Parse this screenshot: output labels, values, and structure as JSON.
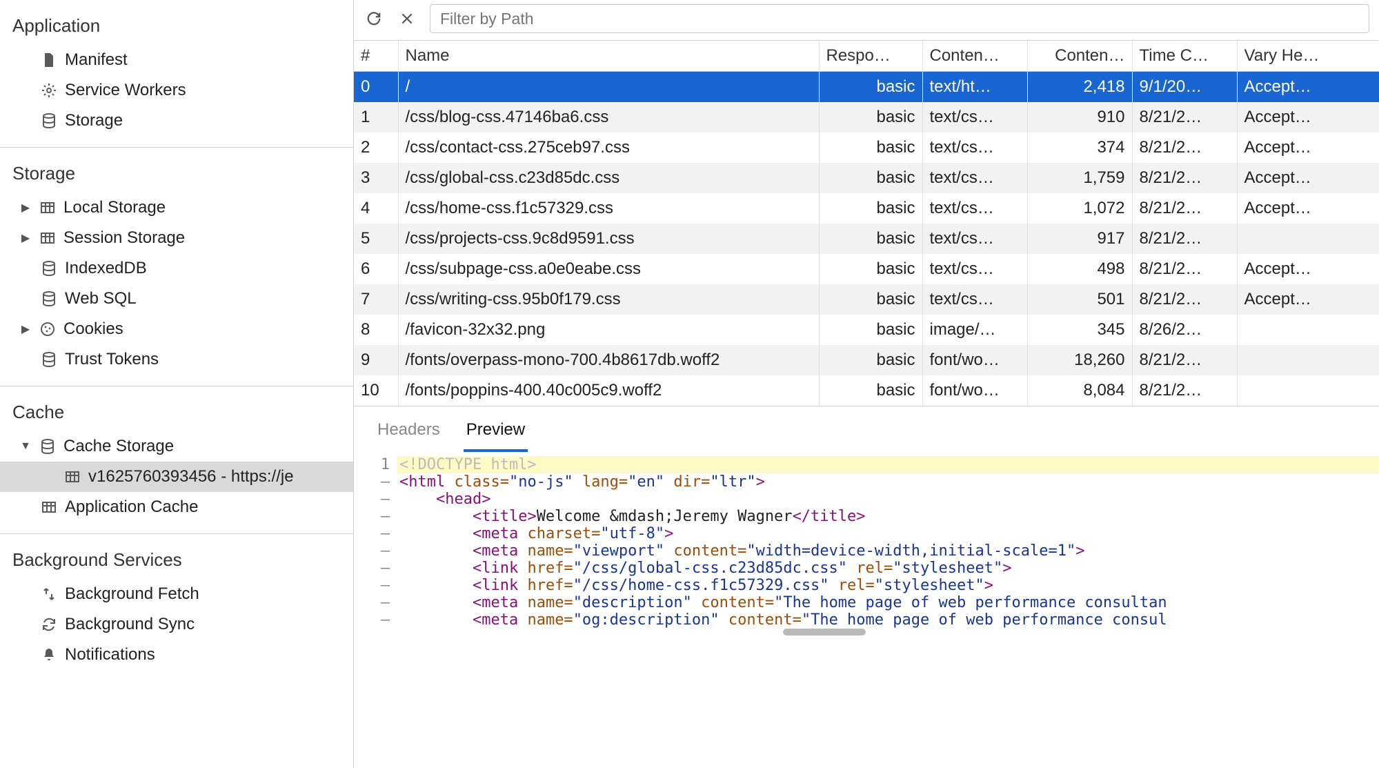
{
  "sidebar": {
    "sections": [
      {
        "header": "Application",
        "items": [
          {
            "name": "manifest",
            "icon": "file-icon",
            "label": "Manifest"
          },
          {
            "name": "service-workers",
            "icon": "gear-icon",
            "label": "Service Workers"
          },
          {
            "name": "storage",
            "icon": "database-icon",
            "label": "Storage"
          }
        ]
      },
      {
        "header": "Storage",
        "items": [
          {
            "name": "local-storage",
            "icon": "table-icon",
            "label": "Local Storage",
            "tree": true,
            "arrow": "▶"
          },
          {
            "name": "session-storage",
            "icon": "table-icon",
            "label": "Session Storage",
            "tree": true,
            "arrow": "▶"
          },
          {
            "name": "indexeddb",
            "icon": "database-icon",
            "label": "IndexedDB"
          },
          {
            "name": "web-sql",
            "icon": "database-icon",
            "label": "Web SQL"
          },
          {
            "name": "cookies",
            "icon": "cookie-icon",
            "label": "Cookies",
            "tree": true,
            "arrow": "▶"
          },
          {
            "name": "trust-tokens",
            "icon": "database-icon",
            "label": "Trust Tokens"
          }
        ]
      },
      {
        "header": "Cache",
        "items": [
          {
            "name": "cache-storage",
            "icon": "database-icon",
            "label": "Cache Storage",
            "tree": true,
            "arrow": "▼"
          },
          {
            "name": "cache-entry",
            "icon": "table-icon",
            "label": "v1625760393456 - https://je",
            "indent": 2,
            "selected": true
          },
          {
            "name": "application-cache",
            "icon": "table-icon",
            "label": "Application Cache"
          }
        ]
      },
      {
        "header": "Background Services",
        "no_border": true,
        "items": [
          {
            "name": "background-fetch",
            "icon": "fetch-icon",
            "label": "Background Fetch"
          },
          {
            "name": "background-sync",
            "icon": "sync-icon",
            "label": "Background Sync"
          },
          {
            "name": "notifications",
            "icon": "bell-icon",
            "label": "Notifications"
          }
        ]
      }
    ]
  },
  "toolbar": {
    "filter_placeholder": "Filter by Path"
  },
  "table": {
    "columns": [
      "#",
      "Name",
      "Respo…",
      "Conten…",
      "Conten…",
      "Time C…",
      "Vary He…"
    ],
    "rows": [
      {
        "idx": "0",
        "name": "/",
        "resp": "basic",
        "ct": "text/ht…",
        "cl": "2,418",
        "tc": "9/1/20…",
        "vh": "Accept…",
        "selected": true
      },
      {
        "idx": "1",
        "name": "/css/blog-css.47146ba6.css",
        "resp": "basic",
        "ct": "text/cs…",
        "cl": "910",
        "tc": "8/21/2…",
        "vh": "Accept…"
      },
      {
        "idx": "2",
        "name": "/css/contact-css.275ceb97.css",
        "resp": "basic",
        "ct": "text/cs…",
        "cl": "374",
        "tc": "8/21/2…",
        "vh": "Accept…"
      },
      {
        "idx": "3",
        "name": "/css/global-css.c23d85dc.css",
        "resp": "basic",
        "ct": "text/cs…",
        "cl": "1,759",
        "tc": "8/21/2…",
        "vh": "Accept…"
      },
      {
        "idx": "4",
        "name": "/css/home-css.f1c57329.css",
        "resp": "basic",
        "ct": "text/cs…",
        "cl": "1,072",
        "tc": "8/21/2…",
        "vh": "Accept…"
      },
      {
        "idx": "5",
        "name": "/css/projects-css.9c8d9591.css",
        "resp": "basic",
        "ct": "text/cs…",
        "cl": "917",
        "tc": "8/21/2…",
        "vh": ""
      },
      {
        "idx": "6",
        "name": "/css/subpage-css.a0e0eabe.css",
        "resp": "basic",
        "ct": "text/cs…",
        "cl": "498",
        "tc": "8/21/2…",
        "vh": "Accept…"
      },
      {
        "idx": "7",
        "name": "/css/writing-css.95b0f179.css",
        "resp": "basic",
        "ct": "text/cs…",
        "cl": "501",
        "tc": "8/21/2…",
        "vh": "Accept…"
      },
      {
        "idx": "8",
        "name": "/favicon-32x32.png",
        "resp": "basic",
        "ct": "image/…",
        "cl": "345",
        "tc": "8/26/2…",
        "vh": ""
      },
      {
        "idx": "9",
        "name": "/fonts/overpass-mono-700.4b8617db.woff2",
        "resp": "basic",
        "ct": "font/wo…",
        "cl": "18,260",
        "tc": "8/21/2…",
        "vh": ""
      },
      {
        "idx": "10",
        "name": "/fonts/poppins-400.40c005c9.woff2",
        "resp": "basic",
        "ct": "font/wo…",
        "cl": "8,084",
        "tc": "8/21/2…",
        "vh": ""
      }
    ]
  },
  "detail": {
    "tabs": [
      {
        "name": "headers",
        "label": "Headers"
      },
      {
        "name": "preview",
        "label": "Preview",
        "active": true
      }
    ],
    "preview_lines": [
      {
        "n": "1",
        "hl": true,
        "tokens": [
          {
            "t": "decl",
            "v": "<!DOCTYPE html>"
          }
        ]
      },
      {
        "n": "–",
        "tokens": [
          {
            "t": "tag",
            "v": "<html "
          },
          {
            "t": "attr",
            "v": "class="
          },
          {
            "t": "val",
            "v": "\"no-js\""
          },
          {
            "t": "tag",
            "v": " "
          },
          {
            "t": "attr",
            "v": "lang="
          },
          {
            "t": "val",
            "v": "\"en\""
          },
          {
            "t": "tag",
            "v": " "
          },
          {
            "t": "attr",
            "v": "dir="
          },
          {
            "t": "val",
            "v": "\"ltr\""
          },
          {
            "t": "tag",
            "v": ">"
          }
        ]
      },
      {
        "n": "–",
        "tokens": [
          {
            "t": "text",
            "v": "    "
          },
          {
            "t": "tag",
            "v": "<head>"
          }
        ]
      },
      {
        "n": "–",
        "tokens": [
          {
            "t": "text",
            "v": "        "
          },
          {
            "t": "tag",
            "v": "<title>"
          },
          {
            "t": "text",
            "v": "Welcome &mdash;Jeremy Wagner"
          },
          {
            "t": "tag",
            "v": "</title>"
          }
        ]
      },
      {
        "n": "–",
        "tokens": [
          {
            "t": "text",
            "v": "        "
          },
          {
            "t": "tag",
            "v": "<meta "
          },
          {
            "t": "attr",
            "v": "charset="
          },
          {
            "t": "val",
            "v": "\"utf-8\""
          },
          {
            "t": "tag",
            "v": ">"
          }
        ]
      },
      {
        "n": "–",
        "tokens": [
          {
            "t": "text",
            "v": "        "
          },
          {
            "t": "tag",
            "v": "<meta "
          },
          {
            "t": "attr",
            "v": "name="
          },
          {
            "t": "val",
            "v": "\"viewport\""
          },
          {
            "t": "tag",
            "v": " "
          },
          {
            "t": "attr",
            "v": "content="
          },
          {
            "t": "val",
            "v": "\"width=device-width,initial-scale=1\""
          },
          {
            "t": "tag",
            "v": ">"
          }
        ]
      },
      {
        "n": "–",
        "tokens": [
          {
            "t": "text",
            "v": "        "
          },
          {
            "t": "tag",
            "v": "<link "
          },
          {
            "t": "attr",
            "v": "href="
          },
          {
            "t": "val",
            "v": "\"/css/global-css.c23d85dc.css\""
          },
          {
            "t": "tag",
            "v": " "
          },
          {
            "t": "attr",
            "v": "rel="
          },
          {
            "t": "val",
            "v": "\"stylesheet\""
          },
          {
            "t": "tag",
            "v": ">"
          }
        ]
      },
      {
        "n": "–",
        "tokens": [
          {
            "t": "text",
            "v": "        "
          },
          {
            "t": "tag",
            "v": "<link "
          },
          {
            "t": "attr",
            "v": "href="
          },
          {
            "t": "val",
            "v": "\"/css/home-css.f1c57329.css\""
          },
          {
            "t": "tag",
            "v": " "
          },
          {
            "t": "attr",
            "v": "rel="
          },
          {
            "t": "val",
            "v": "\"stylesheet\""
          },
          {
            "t": "tag",
            "v": ">"
          }
        ]
      },
      {
        "n": "–",
        "tokens": [
          {
            "t": "text",
            "v": "        "
          },
          {
            "t": "tag",
            "v": "<meta "
          },
          {
            "t": "attr",
            "v": "name="
          },
          {
            "t": "val",
            "v": "\"description\""
          },
          {
            "t": "tag",
            "v": " "
          },
          {
            "t": "attr",
            "v": "content="
          },
          {
            "t": "val",
            "v": "\"The home page of web performance consultan"
          }
        ]
      },
      {
        "n": "–",
        "tokens": [
          {
            "t": "text",
            "v": "        "
          },
          {
            "t": "tag",
            "v": "<meta "
          },
          {
            "t": "attr",
            "v": "name="
          },
          {
            "t": "val",
            "v": "\"og:description\""
          },
          {
            "t": "tag",
            "v": " "
          },
          {
            "t": "attr",
            "v": "content="
          },
          {
            "t": "val",
            "v": "\"The home page of web performance consul"
          }
        ]
      }
    ]
  }
}
